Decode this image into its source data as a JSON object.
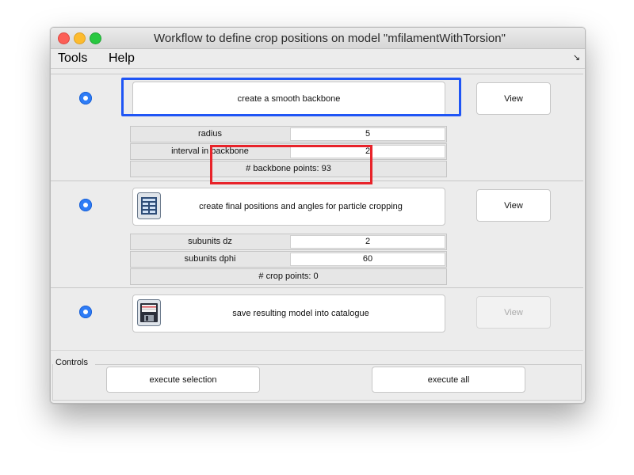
{
  "window": {
    "title": "Workflow to define crop positions on model \"mfilamentWithTorsion\""
  },
  "menu": {
    "items": [
      "Tools",
      "Help"
    ],
    "corner_arrow": "↘"
  },
  "steps": [
    {
      "action_label": "create a smooth backbone",
      "view_label": "View",
      "params": [
        {
          "label": "radius",
          "value": "5"
        },
        {
          "label": "interval in backbone",
          "value": "2"
        }
      ],
      "info": "# backbone points: 93"
    },
    {
      "action_label": "create final positions and angles for particle cropping",
      "view_label": "View",
      "icon": "table-grid-icon",
      "params": [
        {
          "label": "subunits dz",
          "value": "2"
        },
        {
          "label": "subunits dphi",
          "value": "60"
        }
      ],
      "info": "# crop points: 0"
    },
    {
      "action_label": "save resulting model into catalogue",
      "view_label": "View",
      "view_disabled": true,
      "icon": "floppy-save-icon"
    }
  ],
  "controls": {
    "label": "Controls",
    "execute_selection": "execute selection",
    "execute_all": "execute all"
  },
  "colors": {
    "selection_highlight": "#1f55f5",
    "annotation_highlight": "#e8232a",
    "radio": "#2e7cf6"
  }
}
